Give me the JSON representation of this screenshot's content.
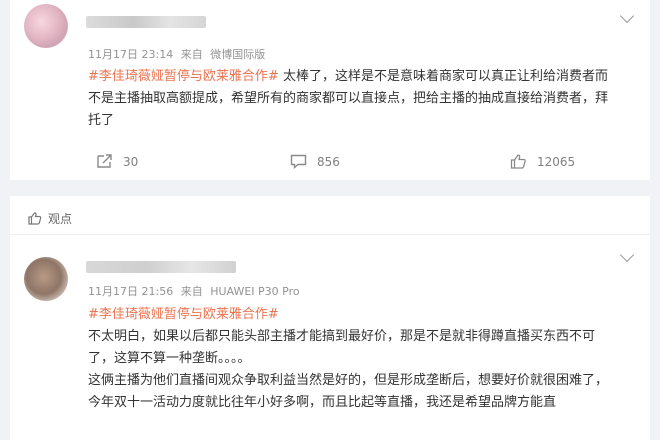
{
  "comments": [
    {
      "timestamp": "11月17日 23:14",
      "source_prefix": "来自",
      "source": "微博国际版",
      "tag": "#李佳琦薇娅暂停与欧莱雅合作#",
      "text_first": "太棒了，这样是不是意味着商家可以真正让利给消费者",
      "text_rest": "而不是主播抽取高额提成，希望所有的商家都可以直接点，把给主播的抽成直接给消费者，拜托了",
      "actions": {
        "repost_count": "30",
        "comment_count": "856",
        "like_count": "12065"
      }
    },
    {
      "timestamp": "11月17日 21:56",
      "source_prefix": "来自",
      "source": "HUAWEI P30 Pro",
      "tag": "#李佳琦薇娅暂停与欧莱雅合作#",
      "para1": "不太明白，如果以后都只能头部主播才能搞到最好价，那是不是就非得蹲直播买东西不可了，这算不算一种垄断。。。。",
      "para2": "这俩主播为他们直播间观众争取利益当然是好的，但是形成垄断后，想要好价就很困难了，今年双十一活动力度就比往年小好多啊，而且比起等直播，我还是希望品牌方能直"
    }
  ],
  "section": {
    "label": "观点"
  },
  "colors": {
    "tag": "#eb7350",
    "text": "#333333",
    "meta": "#939393",
    "background": "#f1f2f5"
  },
  "icons": [
    "chevron-down-icon",
    "repost-icon",
    "comment-icon",
    "like-icon",
    "viewpoint-icon"
  ]
}
